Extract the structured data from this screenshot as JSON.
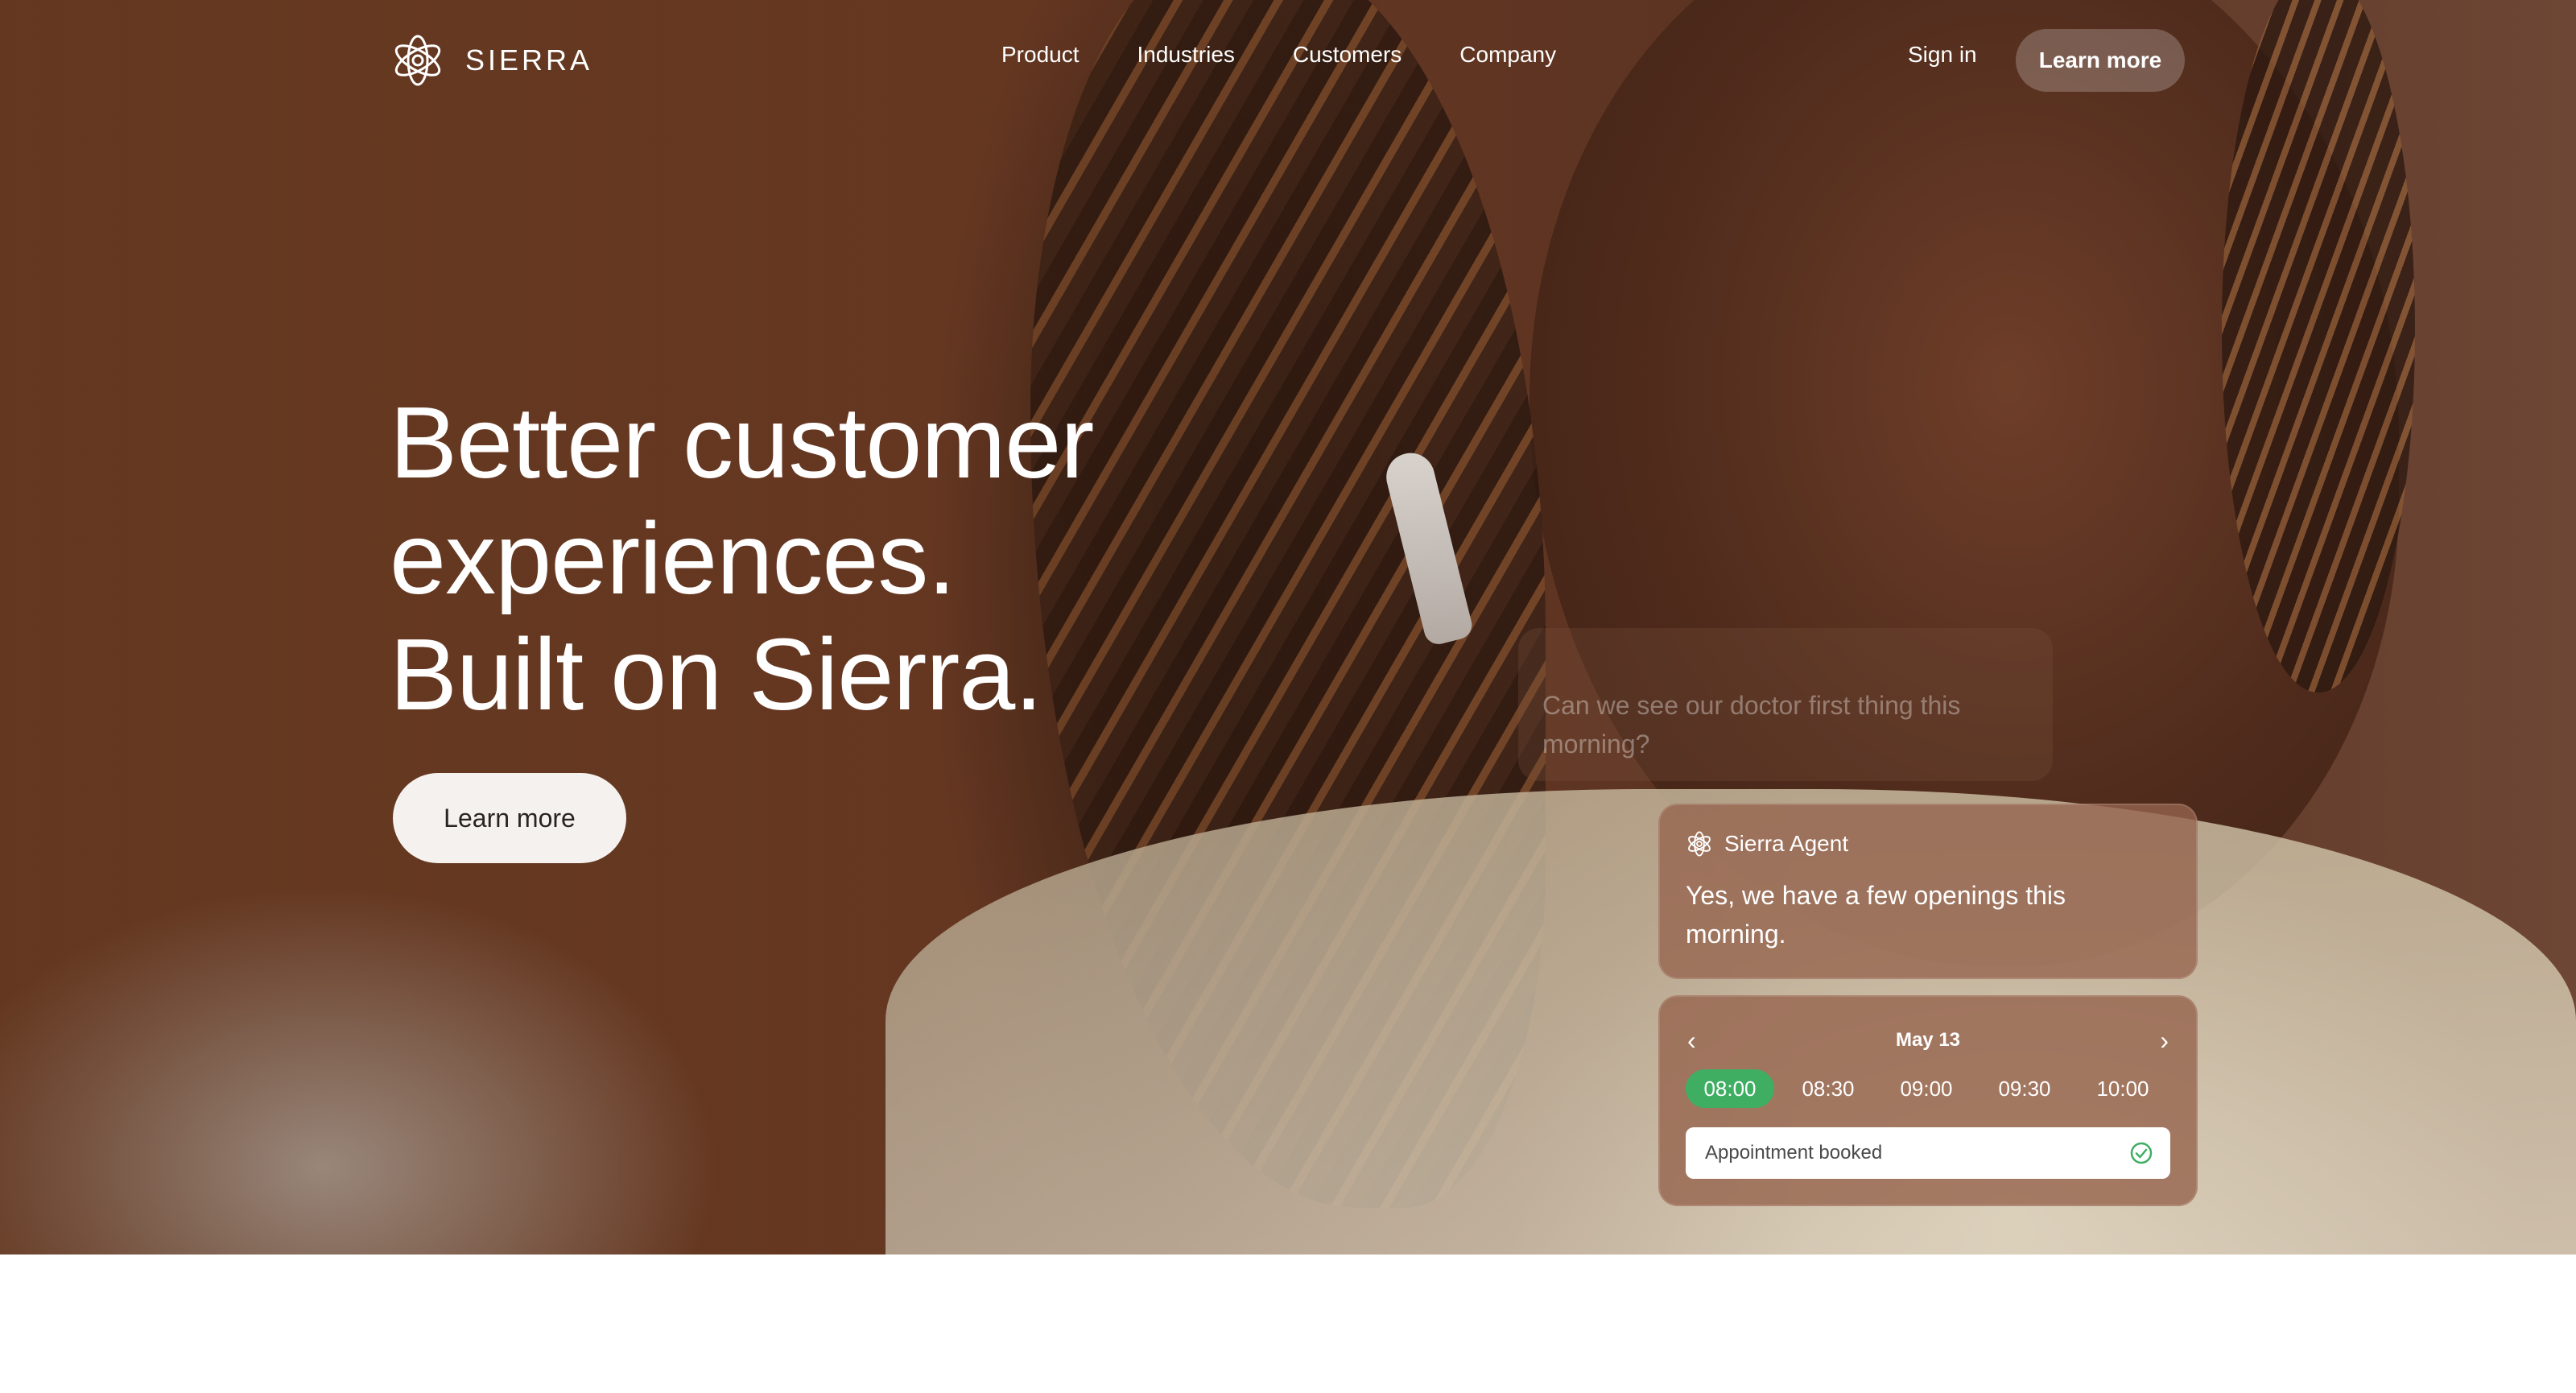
{
  "nav": {
    "brand": "SIERRA",
    "links": [
      "Product",
      "Industries",
      "Customers",
      "Company"
    ],
    "sign_in": "Sign in",
    "cta": "Learn more"
  },
  "hero": {
    "headline": [
      "Better customer",
      "experiences.",
      "Built on Sierra."
    ],
    "cta": "Learn more"
  },
  "chat": {
    "user_message": "Can we see our doctor first thing this morning?",
    "agent": {
      "name": "Sierra Agent",
      "message": "Yes, we have a few openings this morning."
    },
    "calendar": {
      "date": "May 13",
      "slots": [
        "08:00",
        "08:30",
        "09:00",
        "09:30",
        "10:00"
      ],
      "selected_slot": "08:00",
      "status": "Appointment booked"
    }
  },
  "colors": {
    "accent_green": "#3fae63",
    "hero_brown": "#6d3c25",
    "button_light": "#f5f1ee"
  }
}
